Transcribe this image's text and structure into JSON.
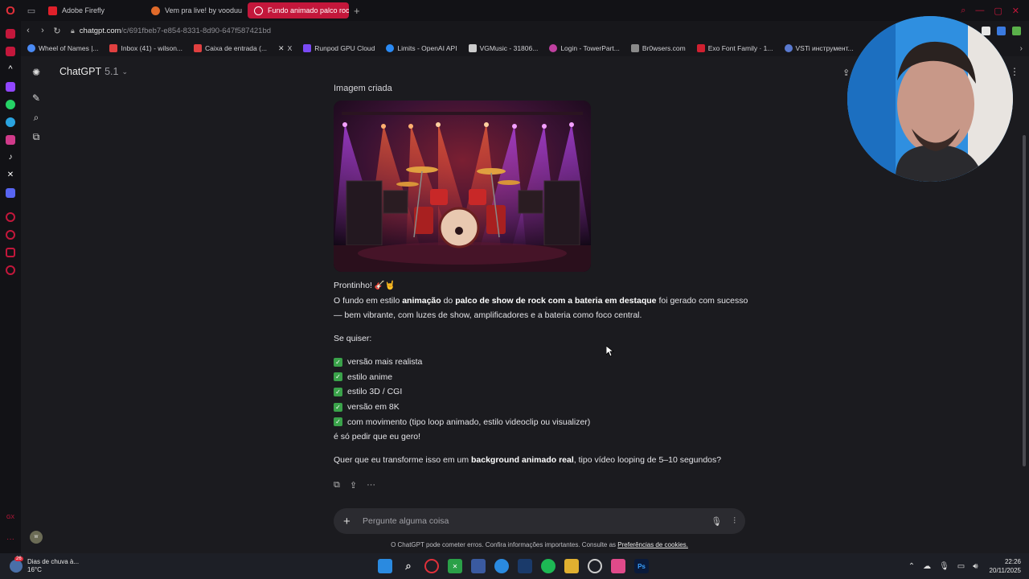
{
  "browser": {
    "tabs": [
      {
        "label": "Adobe Firefly",
        "color": "#e0202a",
        "active": false
      },
      {
        "label": "Vem pra live! by vooduu",
        "color": "#e06a2a",
        "active": false
      },
      {
        "label": "Fundo animado palco roc",
        "color": "#ffffff",
        "active": true
      }
    ],
    "url_host": "chatgpt.com",
    "url_path": "/c/691fbeb7-e854-8331-8d90-647f587421bd",
    "bookmarks": [
      {
        "label": "Wheel of Names |...",
        "color": "#4a8af4"
      },
      {
        "label": "Inbox (41) - wilson...",
        "color": "#e04040"
      },
      {
        "label": "Caixa de entrada (...",
        "color": "#e04040"
      },
      {
        "label": "X",
        "color": "#dddddd"
      },
      {
        "label": "Runpod GPU Cloud",
        "color": "#7a4af4"
      },
      {
        "label": "Limits - OpenAI API",
        "color": "#2a8af4"
      },
      {
        "label": "VGMusic - 31806...",
        "color": "#cccccc"
      },
      {
        "label": "Login - TowerPart...",
        "color": "#c040a0"
      },
      {
        "label": "Br0wsers.com",
        "color": "#8a8a8a"
      },
      {
        "label": "Exo Font Family · 1...",
        "color": "#d02030"
      },
      {
        "label": "VSTi инструмент...",
        "color": "#5a7ad0"
      }
    ]
  },
  "chat": {
    "model_name": "ChatGPT",
    "model_version": "5.1",
    "image_label": "Imagem criada",
    "p1_intro": "Prontinho! 🎸🤘",
    "p1_a": "O fundo em estilo ",
    "p1_b": "animação",
    "p1_c": " do ",
    "p1_d": "palco de show de rock com a bateria em destaque",
    "p1_e": " foi gerado com sucesso — bem vibrante, com luzes de show, amplificadores e a bateria como foco central.",
    "p2": "Se quiser:",
    "options": [
      "versão mais realista",
      "estilo anime",
      "estilo 3D / CGI",
      "versão em 8K",
      "com movimento (tipo loop animado, estilo videoclip ou visualizer)"
    ],
    "p3": "é só pedir que eu gero!",
    "p4_a": "Quer que eu transforme isso em um ",
    "p4_b": "background animado real",
    "p4_c": ", tipo vídeo looping de 5–10 segundos?"
  },
  "composer": {
    "placeholder": "Pergunte alguma coisa",
    "disclaimer": "O ChatGPT pode cometer erros. Confira informações importantes. Consulte as",
    "disclaimer_link": "Preferências de cookies."
  },
  "taskbar": {
    "weather_title": "Dias de chuva à...",
    "weather_temp": "16°C",
    "weather_badge": "26",
    "time": "22:26",
    "date": "20/11/2025"
  }
}
